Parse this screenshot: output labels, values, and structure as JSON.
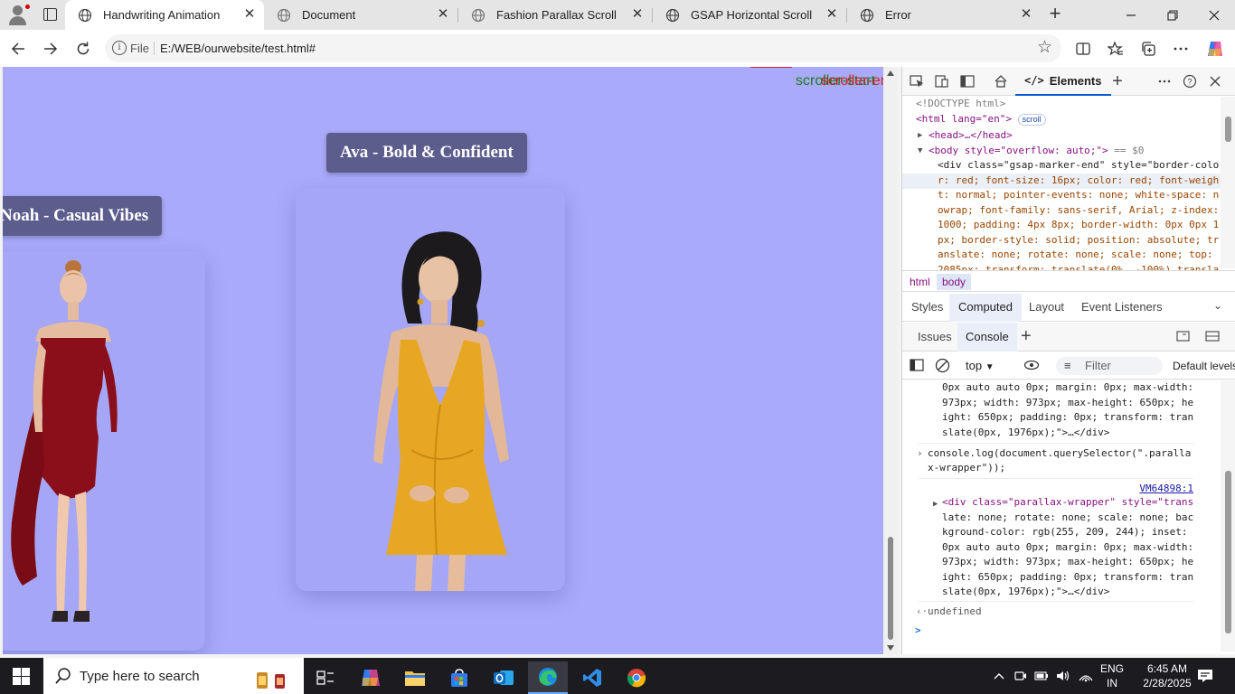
{
  "browser": {
    "tabs": [
      {
        "title": "Handwriting Animation",
        "active": true
      },
      {
        "title": "Document",
        "active": false
      },
      {
        "title": "Fashion Parallax Scroll",
        "active": false
      },
      {
        "title": "GSAP Horizontal Scroll",
        "active": false
      },
      {
        "title": "Error",
        "active": false
      }
    ],
    "address": {
      "scheme_label": "File",
      "url": "E:/WEB/ourwebsite/test.html#"
    }
  },
  "page": {
    "markers": {
      "start": "scroller-start",
      "end": "scroller-end"
    },
    "cards": [
      {
        "label": "Noah - Casual Vibes",
        "dress_color": "#8b0f1a"
      },
      {
        "label": "Ava - Bold & Confident",
        "dress_color": "#e8a722"
      }
    ],
    "background": "#aaaafc"
  },
  "devtools": {
    "main_tab": "Elements",
    "dom_lines": [
      {
        "indent": 0,
        "text": "<!DOCTYPE html>"
      },
      {
        "indent": 0,
        "text": "<html lang=\"en\">",
        "badge": "scroll"
      },
      {
        "indent": 1,
        "text": "<head>…</head>"
      },
      {
        "indent": 1,
        "text": "<body style=\"overflow: auto;\">",
        "suffix": " == $0"
      },
      {
        "indent": 2,
        "text": "<div class=\"gsap-marker-end\" style=\"border-colo"
      },
      {
        "indent": 3,
        "text": "r: red; font-size: 16px; color: red; font-weigh"
      },
      {
        "indent": 3,
        "text": "t: normal; pointer-events: none; white-space: n"
      },
      {
        "indent": 3,
        "text": "owrap; font-family: sans-serif, Arial; z-index:"
      },
      {
        "indent": 3,
        "text": "1000; padding: 4px 8px; border-width: 0px 0px 1"
      },
      {
        "indent": 3,
        "text": "px; border-style: solid; position: absolute; tr"
      },
      {
        "indent": 3,
        "text": "anslate: none; rotate: none; scale: none; top:"
      },
      {
        "indent": 3,
        "text": "2085px; transform: translate(0%, -100%) transla"
      }
    ],
    "breadcrumbs": [
      "html",
      "body"
    ],
    "style_tabs": [
      "Styles",
      "Computed",
      "Layout",
      "Event Listeners"
    ],
    "style_tab_active": "Computed",
    "drawer_tabs": [
      "Issues",
      "Console"
    ],
    "drawer_tab_active": "Console",
    "console_toolbar": {
      "context": "top",
      "filter_placeholder": "Filter",
      "levels": "Default levels"
    },
    "console_lines": [
      "0px auto auto 0px; margin: 0px; max-width:",
      "973px; width: 973px; max-height: 650px; he",
      "ight: 650px; padding: 0px; transform: tran",
      "slate(0px, 1976px);\">…</div>"
    ],
    "console_input": "console.log(document.querySelector(\".paralla",
    "console_input_2": "x-wrapper\"));",
    "console_source": "VM64898:1",
    "console_output": [
      "<div class=\"parallax-wrapper\" style=\"trans",
      "late: none; rotate: none; scale: none; bac",
      "kground-color: rgb(255, 209, 244); inset:",
      "0px auto auto 0px; margin: 0px; max-width:",
      "973px; width: 973px; max-height: 650px; he",
      "ight: 650px; padding: 0px; transform: tran",
      "slate(0px, 1976px);\">…</div>"
    ],
    "console_return": "undefined",
    "prompt_glyph": ">"
  },
  "taskbar": {
    "search_placeholder": "Type here to search",
    "language": "ENG",
    "region": "IN",
    "time": "6:45 AM",
    "date": "2/28/2025"
  }
}
